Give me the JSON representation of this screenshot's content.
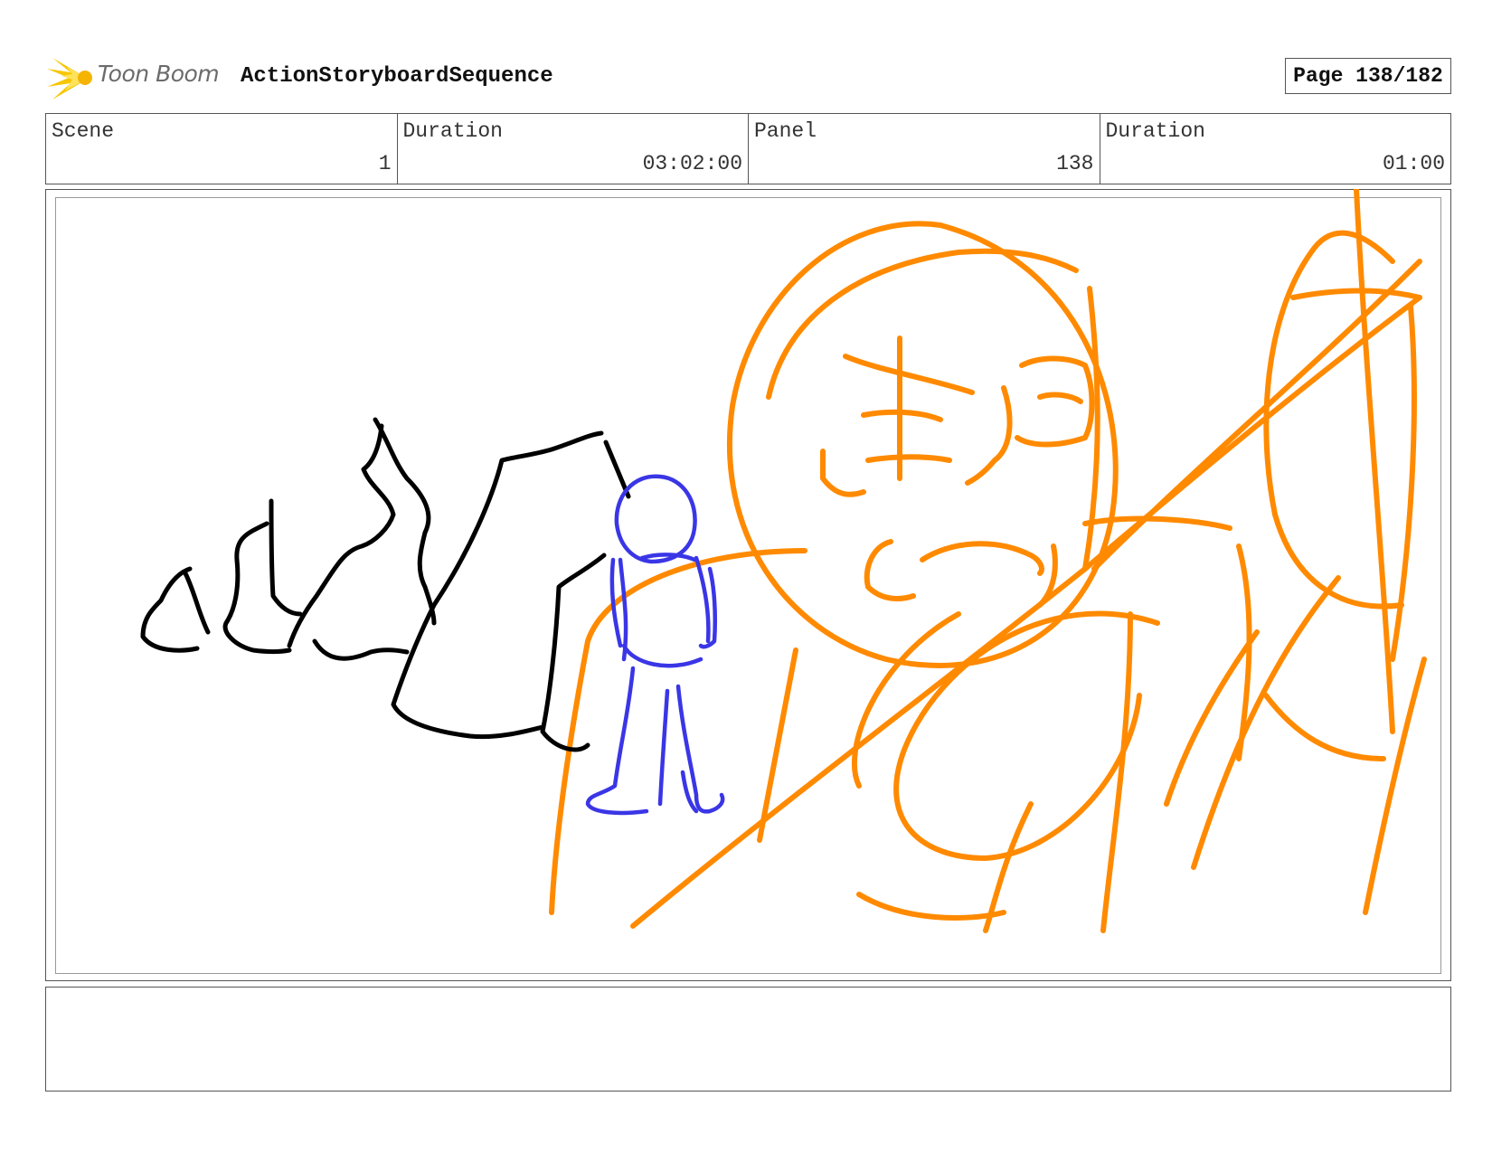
{
  "header": {
    "logo_text": "Toon Boom",
    "sequence_title": "ActionStoryboardSequence",
    "page": "Page 138/182"
  },
  "info": {
    "scene_label": "Scene",
    "scene_value": "1",
    "scene_duration_label": "Duration",
    "scene_duration_value": "03:02:00",
    "panel_label": "Panel",
    "panel_value": "138",
    "panel_duration_label": "Duration",
    "panel_duration_value": "01:00"
  },
  "colors": {
    "orange": "#ff8a00",
    "blue": "#3a36e6",
    "black": "#000000",
    "logo_yellow": "#f5c400"
  },
  "notes": ""
}
